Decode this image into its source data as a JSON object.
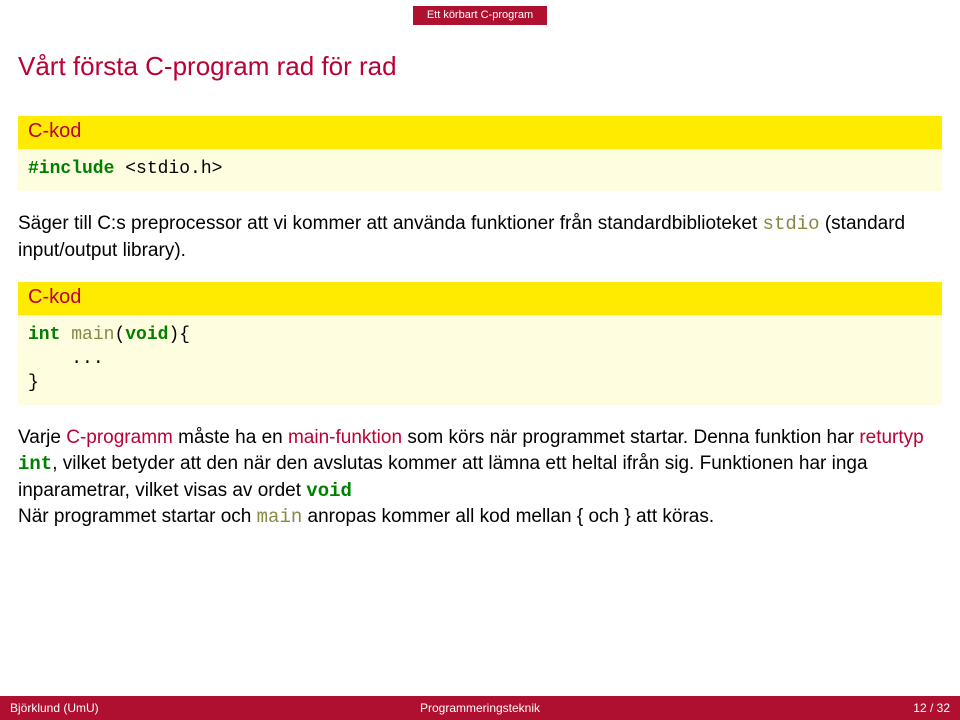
{
  "topnav": {
    "crumb": "Ett körbart C-program"
  },
  "title": "Vårt första C-program rad för rad",
  "blocks": {
    "b1": {
      "head": "C-kod",
      "code": {
        "line1_pre": "#include ",
        "line1_rest": "<stdio.h>"
      }
    },
    "b2": {
      "head": "C-kod",
      "code": {
        "kw_int": "int",
        "sp1": " ",
        "fn_main": "main",
        "lp": "(",
        "kw_void": "void",
        "rp_brace": "){",
        "indent": "    ",
        "dots": "...",
        "rbrace": "}"
      }
    }
  },
  "para1": {
    "t1": "Säger till C:s preprocessor att vi kommer att använda funktioner från standardbiblioteket ",
    "mono": "stdio",
    "t2": " (standard input/output library)."
  },
  "para2": {
    "t1": "Varje ",
    "hl1": "C-programm",
    "t2": " måste ha en ",
    "hl2": "main-funktion",
    "t3": " som körs när programmet startar. Denna funktion har ",
    "hl3": "returtyp",
    "sp": " ",
    "kw_int": "int",
    "t4": ", vilket betyder att den när den avslutas kommer att lämna ett heltal ifrån sig. Funktionen har inga inparametrar, vilket visas av ordet ",
    "kw_void": "void",
    "br": "",
    "t5": "När programmet startar och ",
    "mono_main": "main",
    "t6": " anropas kommer all kod mellan { och } att köras."
  },
  "footer": {
    "left": "Björklund (UmU)",
    "center": "Programmeringsteknik",
    "right": "12 / 32"
  }
}
